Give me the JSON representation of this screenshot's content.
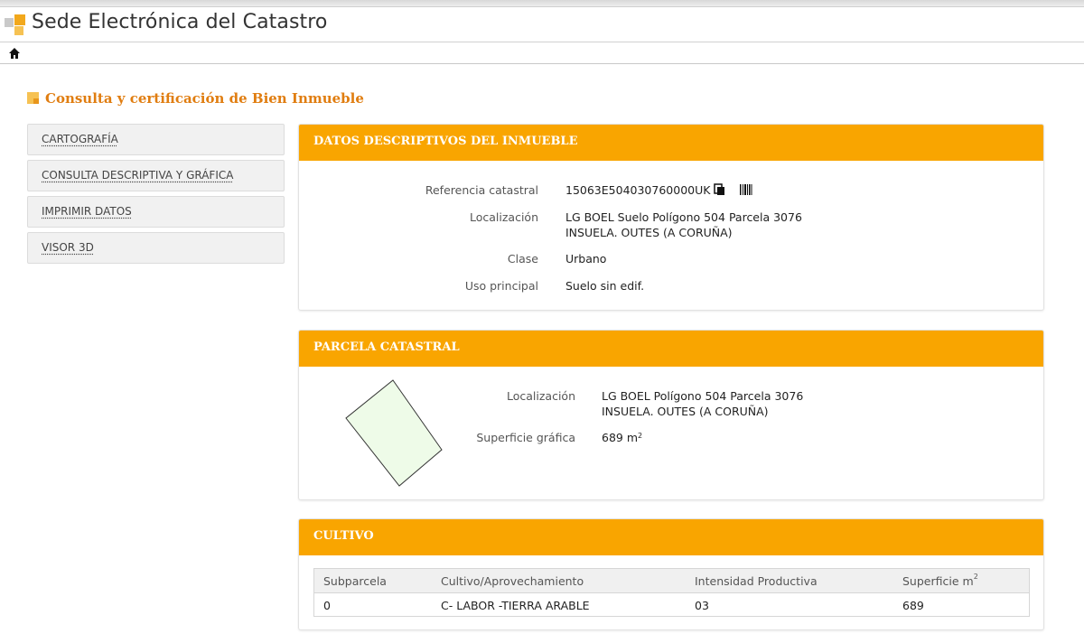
{
  "header": {
    "site_title": "Sede Electrónica del Catastro"
  },
  "nav": {
    "home_icon": "home-icon"
  },
  "page": {
    "title": "Consulta y certificación de Bien Inmueble"
  },
  "side_menu": {
    "items": [
      {
        "label": "CARTOGRAFÍA"
      },
      {
        "label": "CONSULTA DESCRIPTIVA Y GRÁFICA"
      },
      {
        "label": "IMPRIMIR DATOS"
      },
      {
        "label": "VISOR 3D"
      }
    ]
  },
  "datos": {
    "heading": "DATOS DESCRIPTIVOS DEL INMUEBLE",
    "referencia_label": "Referencia catastral",
    "referencia_value": "15063E504030760000UK",
    "localizacion_label": "Localización",
    "localizacion_line1": "LG BOEL Suelo Polígono 504 Parcela 3076",
    "localizacion_line2": "INSUELA. OUTES (A CORUÑA)",
    "clase_label": "Clase",
    "clase_value": "Urbano",
    "uso_label": "Uso principal",
    "uso_value": "Suelo sin edif."
  },
  "parcela": {
    "heading": "PARCELA CATASTRAL",
    "localizacion_label": "Localización",
    "localizacion_line1": "LG BOEL Polígono 504 Parcela 3076",
    "localizacion_line2": "INSUELA. OUTES (A CORUÑA)",
    "superficie_label": "Superficie gráfica",
    "superficie_value": "689 m",
    "superficie_unit_sup": "2"
  },
  "cultivo": {
    "heading": "CULTIVO",
    "columns": [
      "Subparcela",
      "Cultivo/Aprovechamiento",
      "Intensidad Productiva",
      "Superficie m"
    ],
    "column_sup": "2",
    "rows": [
      [
        "0",
        "C- LABOR -TIERRA ARABLE",
        "03",
        "689"
      ]
    ]
  },
  "colors": {
    "accent_orange": "#f9a500",
    "title_orange": "#e07d10",
    "parcel_fill": "#eefbe8"
  }
}
